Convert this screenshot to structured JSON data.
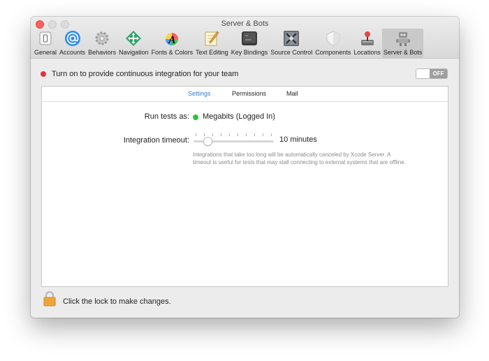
{
  "window": {
    "title": "Server & Bots"
  },
  "toolbar": {
    "items": [
      {
        "label": "General",
        "icon": "general-switch-icon"
      },
      {
        "label": "Accounts",
        "icon": "at-sign-icon"
      },
      {
        "label": "Behaviors",
        "icon": "gears-icon"
      },
      {
        "label": "Navigation",
        "icon": "arrows-icon"
      },
      {
        "label": "Fonts & Colors",
        "icon": "font-palette-icon"
      },
      {
        "label": "Text Editing",
        "icon": "pencil-note-icon"
      },
      {
        "label": "Key Bindings",
        "icon": "keyboard-key-icon"
      },
      {
        "label": "Source Control",
        "icon": "source-control-icon"
      },
      {
        "label": "Components",
        "icon": "shield-icon"
      },
      {
        "label": "Locations",
        "icon": "joystick-icon"
      },
      {
        "label": "Server & Bots",
        "icon": "robot-icon",
        "selected": true
      }
    ]
  },
  "banner": {
    "text": "Turn on to provide continuous integration for your team",
    "toggle_label": "OFF",
    "status_color": "#e8323c"
  },
  "tabs": [
    "Settings",
    "Permissions",
    "Mail"
  ],
  "settings": {
    "run_tests_label": "Run tests as:",
    "run_tests_value": "Megabits (Logged In)",
    "run_tests_status_color": "#31c13f",
    "timeout_label": "Integration timeout:",
    "timeout_value": "10 minutes",
    "timeout_slider_fraction": 0.14,
    "timeout_help": "Integrations that take too long will be automatically canceled by Xcode Server.  A timeout is useful for tests that may stall connecting to external systems that are offline."
  },
  "footer": {
    "lock_text": "Click the lock to make changes."
  },
  "colors": {
    "accent": "#2f7fd0"
  }
}
